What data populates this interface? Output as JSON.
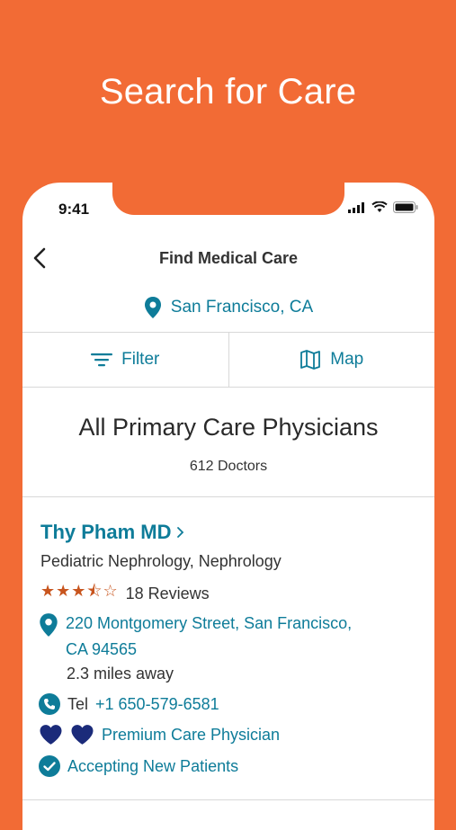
{
  "promo": {
    "title": "Search for Care"
  },
  "status_bar": {
    "time": "9:41"
  },
  "nav": {
    "title": "Find Medical Care"
  },
  "location": {
    "label": "San Francisco, CA"
  },
  "toolbar": {
    "filter_label": "Filter",
    "map_label": "Map"
  },
  "list": {
    "title": "All Primary Care Physicians",
    "count": "612 Doctors"
  },
  "doctor": {
    "name": "Thy Pham MD",
    "specialty": "Pediatric Nephrology, Nephrology",
    "stars": "★★★⯪☆",
    "rating": 3.5,
    "reviews": "18 Reviews",
    "address_line1": "220 Montgomery Street, San Francisco,",
    "address_line2": "CA 94565",
    "distance": "2.3 miles away",
    "tel_label": "Tel",
    "tel_number": "+1 650-579-6581",
    "premium": "Premium Care Physician",
    "accepting": "Accepting New Patients"
  },
  "colors": {
    "brand_orange": "#F26B35",
    "accent_teal": "#0E7C99",
    "star_orange": "#C8551E",
    "heart_navy": "#1B2B7A"
  }
}
